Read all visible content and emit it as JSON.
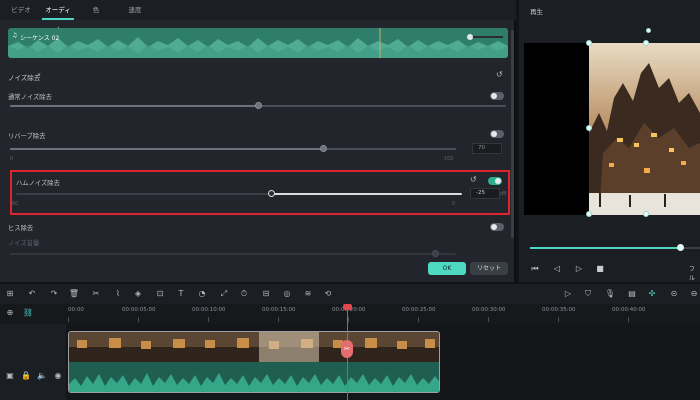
{
  "tabs": [
    "ビデオ",
    "オーディオ",
    "色",
    "速度"
  ],
  "waveform": {
    "label": "シーケンス 02"
  },
  "noise": {
    "title": "ノイズ除去",
    "rows": [
      {
        "label": "通常ノイズ除去",
        "enabled": false,
        "level": 0.5
      },
      {
        "label": "リバーブ除去",
        "enabled": false,
        "level": 0.7,
        "min": "0",
        "max": "100",
        "value": "70"
      },
      {
        "label": "ハムノイズ除去",
        "enabled": true,
        "level": 0.5,
        "min": "-60",
        "max": "0",
        "value": "-25",
        "unit": "dB"
      },
      {
        "label": "ヒス除去",
        "enabled": false,
        "sublabel": "ノイズ音量"
      }
    ]
  },
  "buttons": {
    "ok": "OK",
    "reset": "リセット"
  },
  "player": {
    "title": "再生",
    "progress": 0.88,
    "full_label": "フル"
  },
  "timeline": {
    "ticks": [
      "00:00",
      "00:00:05:00",
      "00:00:10:00",
      "00:00:15:00",
      "00:00:20:00",
      "00:00:25:00",
      "00:00:30:00",
      "00:00:35:00",
      "00:00:40:00"
    ]
  },
  "colors": {
    "accent": "#4dd6c5",
    "highlight": "#d9252b",
    "playhead": "#e2474c"
  }
}
